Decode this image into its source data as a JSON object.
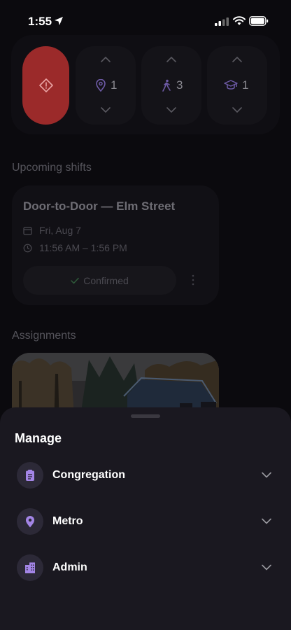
{
  "status_bar": {
    "time": "1:55"
  },
  "steppers": [
    {
      "icon": "location-pin-icon",
      "value": "1"
    },
    {
      "icon": "walking-person-icon",
      "value": "3"
    },
    {
      "icon": "graduation-cap-icon",
      "value": "1"
    }
  ],
  "upcoming": {
    "title": "Upcoming shifts",
    "shift_title": "Door-to-Door — Elm Street",
    "date": "Fri, Aug 7",
    "time": "11:56 AM – 1:56 PM",
    "status": "Confirmed"
  },
  "assignments": {
    "title": "Assignments"
  },
  "sheet": {
    "title": "Manage",
    "items": [
      {
        "label": "Congregation",
        "icon": "clipboard-icon"
      },
      {
        "label": "Metro",
        "icon": "location-pin-icon"
      },
      {
        "label": "Admin",
        "icon": "building-icon"
      }
    ]
  },
  "colors": {
    "accent": "#a385e6",
    "alert": "#9b2a2a",
    "sheet_bg": "#1a1820"
  }
}
